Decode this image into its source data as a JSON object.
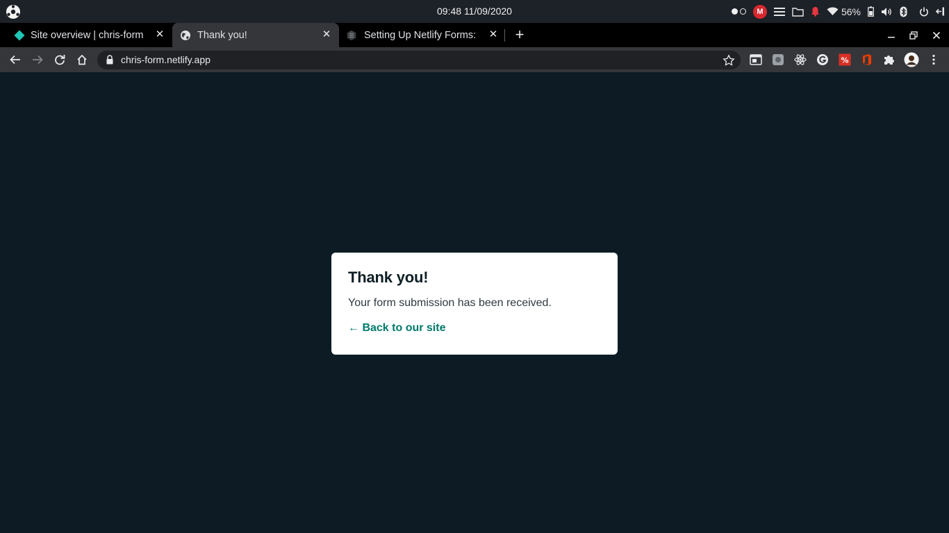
{
  "system_bar": {
    "clock": "09:48  11/09/2020",
    "battery_percent": "56%",
    "icons": [
      "activities-icon",
      "workspace-dots-icon",
      "mega-icon",
      "menu-icon",
      "folder-icon",
      "notification-bell-icon",
      "wifi-icon",
      "battery-icon",
      "volume-icon",
      "bluetooth-icon",
      "power-icon",
      "logout-icon"
    ],
    "mega_label": "M"
  },
  "tabs": [
    {
      "title": "Site overview | chris-form",
      "favicon": "netlify-diamond-icon",
      "active": false
    },
    {
      "title": "Thank you!",
      "favicon": "globe-icon",
      "active": true
    },
    {
      "title": "Setting Up Netlify Forms:",
      "favicon": "stackbit-icon",
      "active": false
    }
  ],
  "browser": {
    "url": "chris-form.netlify.app",
    "accent": "#35363a"
  },
  "page": {
    "title": "Thank you!",
    "message": "Your form submission has been received.",
    "back_link": "← Back to our site",
    "background": "#0d1c24",
    "link_color": "#00796b"
  }
}
